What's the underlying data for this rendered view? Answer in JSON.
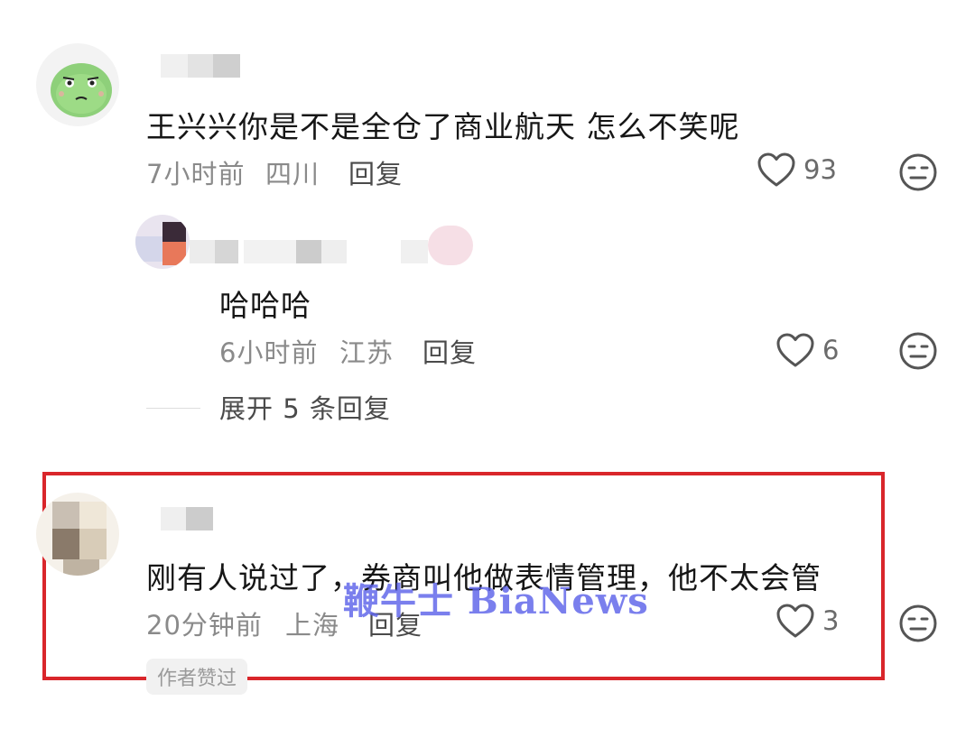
{
  "comments": [
    {
      "text": "王兴兴你是不是全仓了商业航天 怎么不笑呢",
      "time": "7小时前",
      "location": "四川",
      "reply_label": "回复",
      "likes": "93"
    },
    {
      "text": "哈哈哈",
      "time": "6小时前",
      "location": "江苏",
      "reply_label": "回复",
      "likes": "6"
    },
    {
      "text": "刚有人说过了，券商叫他做表情管理，他不太会管",
      "time": "20分钟前",
      "location": "上海",
      "reply_label": "回复",
      "likes": "3",
      "badge": "作者赞过"
    }
  ],
  "expand_replies": "展开 5 条回复",
  "watermark": "鞭牛士 BiaNews",
  "colors": {
    "highlight": "#d9262b",
    "watermark": "#5d63ea"
  }
}
